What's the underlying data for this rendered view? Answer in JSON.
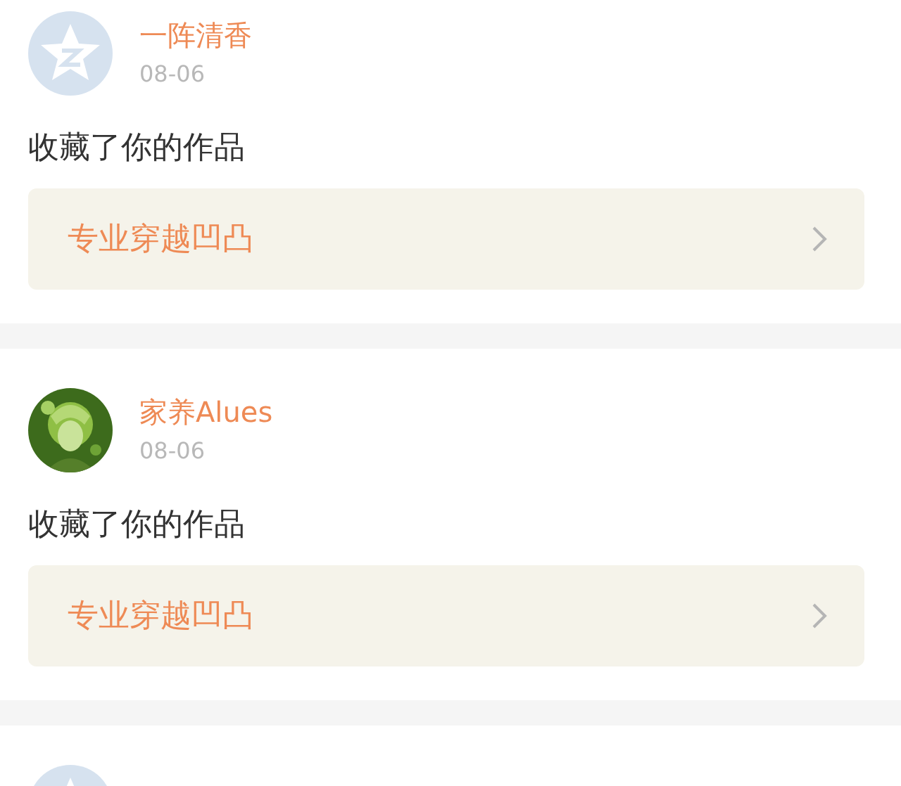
{
  "notifications": [
    {
      "avatar": {
        "kind": "default"
      },
      "name": "一阵清香",
      "date": "08-06",
      "message": "收藏了你的作品",
      "work": "专业穿越凹凸"
    },
    {
      "name": "家养Alues",
      "date": "08-06",
      "message": "收藏了你的作品",
      "work": "专业穿越凹凸"
    },
    {
      "avatar": {
        "kind": "default"
      }
    }
  ]
}
